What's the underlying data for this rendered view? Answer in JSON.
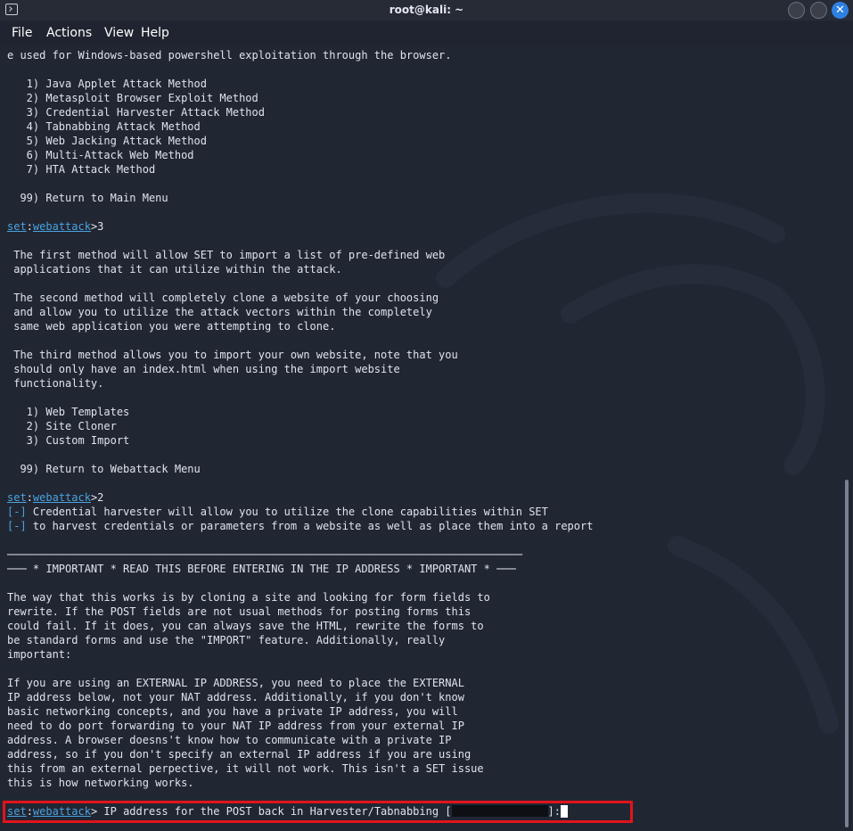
{
  "window": {
    "title": "root@kali: ~",
    "icon": "terminal-icon",
    "controls": [
      "minimize-icon",
      "maximize-icon",
      "close-icon"
    ],
    "close_glyph": "✕"
  },
  "menubar": {
    "items": [
      "File",
      "Actions",
      "View",
      "Help"
    ]
  },
  "colors": {
    "background": "#212633",
    "text": "#e0e3ea",
    "prompt": "#4aa3df",
    "highlight": "#e1141c",
    "close_button": "#2e80e0"
  },
  "terminal": {
    "lines": [
      [
        {
          "t": "text",
          "v": "e used for Windows-based powershell exploitation through the browser."
        }
      ],
      [],
      [
        {
          "t": "text",
          "v": "   1) Java Applet Attack Method"
        }
      ],
      [
        {
          "t": "text",
          "v": "   2) Metasploit Browser Exploit Method"
        }
      ],
      [
        {
          "t": "text",
          "v": "   3) Credential Harvester Attack Method"
        }
      ],
      [
        {
          "t": "text",
          "v": "   4) Tabnabbing Attack Method"
        }
      ],
      [
        {
          "t": "text",
          "v": "   5) Web Jacking Attack Method"
        }
      ],
      [
        {
          "t": "text",
          "v": "   6) Multi-Attack Web Method"
        }
      ],
      [
        {
          "t": "text",
          "v": "   7) HTA Attack Method"
        }
      ],
      [],
      [
        {
          "t": "text",
          "v": "  99) Return to Main Menu"
        }
      ],
      [],
      [
        {
          "t": "prompt-set",
          "v": "set"
        },
        {
          "t": "text",
          "v": ":"
        },
        {
          "t": "prompt-ctx",
          "v": "webattack"
        },
        {
          "t": "text",
          "v": ">3"
        }
      ],
      [],
      [
        {
          "t": "text",
          "v": " The first method will allow SET to import a list of pre-defined web"
        }
      ],
      [
        {
          "t": "text",
          "v": " applications that it can utilize within the attack."
        }
      ],
      [],
      [
        {
          "t": "text",
          "v": " The second method will completely clone a website of your choosing"
        }
      ],
      [
        {
          "t": "text",
          "v": " and allow you to utilize the attack vectors within the completely"
        }
      ],
      [
        {
          "t": "text",
          "v": " same web application you were attempting to clone."
        }
      ],
      [],
      [
        {
          "t": "text",
          "v": " The third method allows you to import your own website, note that you"
        }
      ],
      [
        {
          "t": "text",
          "v": " should only have an index.html when using the import website"
        }
      ],
      [
        {
          "t": "text",
          "v": " functionality."
        }
      ],
      [],
      [
        {
          "t": "text",
          "v": "   1) Web Templates"
        }
      ],
      [
        {
          "t": "text",
          "v": "   2) Site Cloner"
        }
      ],
      [
        {
          "t": "text",
          "v": "   3) Custom Import"
        }
      ],
      [],
      [
        {
          "t": "text",
          "v": "  99) Return to Webattack Menu"
        }
      ],
      [],
      [
        {
          "t": "prompt-set",
          "v": "set"
        },
        {
          "t": "text",
          "v": ":"
        },
        {
          "t": "prompt-ctx",
          "v": "webattack"
        },
        {
          "t": "text",
          "v": ">2"
        }
      ],
      [
        {
          "t": "bracket",
          "v": "[-]"
        },
        {
          "t": "text",
          "v": " Credential harvester will allow you to utilize the clone capabilities within SET"
        }
      ],
      [
        {
          "t": "bracket",
          "v": "[-]"
        },
        {
          "t": "text",
          "v": " to harvest credentials or parameters from a website as well as place them into a report"
        }
      ],
      [],
      [
        {
          "t": "text",
          "v": "────────────────────────────────────────────────────────────────────────────────"
        }
      ],
      [
        {
          "t": "text",
          "v": "─── * IMPORTANT * READ THIS BEFORE ENTERING IN THE IP ADDRESS * IMPORTANT * ───"
        }
      ],
      [],
      [
        {
          "t": "text",
          "v": "The way that this works is by cloning a site and looking for form fields to"
        }
      ],
      [
        {
          "t": "text",
          "v": "rewrite. If the POST fields are not usual methods for posting forms this"
        }
      ],
      [
        {
          "t": "text",
          "v": "could fail. If it does, you can always save the HTML, rewrite the forms to"
        }
      ],
      [
        {
          "t": "text",
          "v": "be standard forms and use the \"IMPORT\" feature. Additionally, really"
        }
      ],
      [
        {
          "t": "text",
          "v": "important:"
        }
      ],
      [],
      [
        {
          "t": "text",
          "v": "If you are using an EXTERNAL IP ADDRESS, you need to place the EXTERNAL"
        }
      ],
      [
        {
          "t": "text",
          "v": "IP address below, not your NAT address. Additionally, if you don't know"
        }
      ],
      [
        {
          "t": "text",
          "v": "basic networking concepts, and you have a private IP address, you will"
        }
      ],
      [
        {
          "t": "text",
          "v": "need to do port forwarding to your NAT IP address from your external IP"
        }
      ],
      [
        {
          "t": "text",
          "v": "address. A browser doesns't know how to communicate with a private IP"
        }
      ],
      [
        {
          "t": "text",
          "v": "address, so if you don't specify an external IP address if you are using"
        }
      ],
      [
        {
          "t": "text",
          "v": "this from an external perpective, it will not work. This isn't a SET issue"
        }
      ],
      [
        {
          "t": "text",
          "v": "this is how networking works."
        }
      ],
      [],
      [
        {
          "t": "prompt-set",
          "v": "set"
        },
        {
          "t": "text",
          "v": ":"
        },
        {
          "t": "prompt-ctx",
          "v": "webattack"
        },
        {
          "t": "text",
          "v": "> IP address for the POST back in Harvester/Tabnabbing ["
        },
        {
          "t": "redacted",
          "v": "               "
        },
        {
          "t": "text",
          "v": "]:"
        },
        {
          "t": "cursor",
          "v": ""
        }
      ]
    ]
  }
}
